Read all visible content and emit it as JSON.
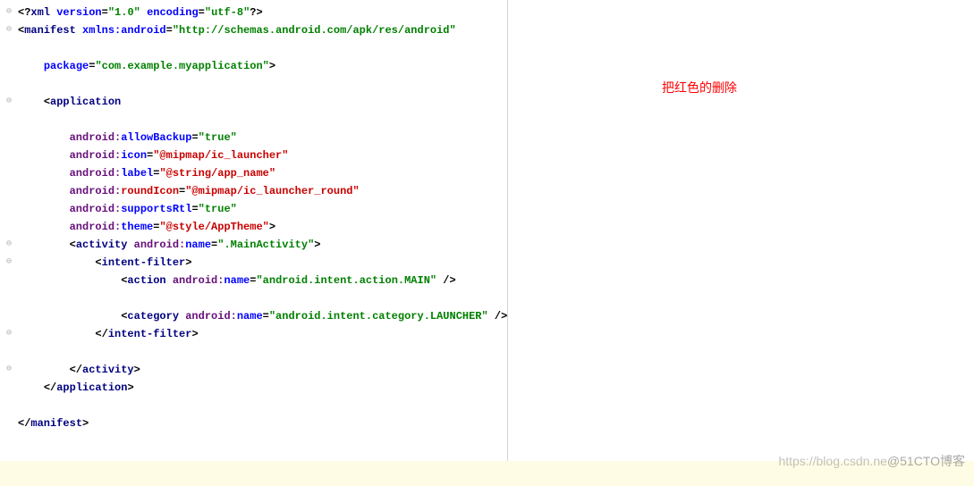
{
  "comment": "把红色的删除",
  "watermark_prefix": "https://blog.csdn.ne",
  "watermark_cn": "@51CTO博客",
  "code": {
    "xml_decl": {
      "open": "<?",
      "tag": "xml ",
      "a1": "version",
      "eq": "=",
      "v1": "\"1.0\"",
      "sp": " ",
      "a2": "encoding",
      "v2": "\"utf-8\"",
      "close": "?>"
    },
    "manifest_open": {
      "open": "<",
      "tag": "manifest ",
      "attr": "xmlns:android",
      "eq": "=",
      "val": "\"http://schemas.android.com/apk/res/android\""
    },
    "package": {
      "attr": "package",
      "eq": "=",
      "val": "\"com.example.myapplication\"",
      "close": ">"
    },
    "app_open": {
      "open": "<",
      "tag": "application"
    },
    "allowBackup": {
      "ns": "android:",
      "name": "allowBackup",
      "eq": "=",
      "val": "\"true\""
    },
    "icon": {
      "ns": "android:",
      "name": "icon",
      "eq": "=",
      "val": "\"@mipmap/ic_launcher\""
    },
    "label": {
      "ns": "android:",
      "name": "label",
      "eq": "=",
      "val": "\"@string/app_name\""
    },
    "roundIcon": {
      "ns": "android:",
      "name": "roundIcon",
      "eq": "=",
      "val": "\"@mipmap/ic_launcher_round\""
    },
    "supportsRtl": {
      "ns": "android:",
      "name": "supportsRtl",
      "eq": "=",
      "val": "\"true\""
    },
    "theme": {
      "ns": "android:",
      "name": "theme",
      "eq": "=",
      "val": "\"@style/AppTheme\"",
      "close": ">"
    },
    "activity": {
      "open": "<",
      "tag": "activity ",
      "ns": "android:",
      "name": "name",
      "eq": "=",
      "val": "\".MainActivity\"",
      "close": ">"
    },
    "intent_open": {
      "open": "<",
      "tag": "intent-filter",
      "close": ">"
    },
    "action": {
      "open": "<",
      "tag": "action ",
      "ns": "android:",
      "name": "name",
      "eq": "=",
      "val": "\"android.intent.action.MAIN\"",
      "close": " />"
    },
    "category": {
      "open": "<",
      "tag": "category ",
      "ns": "android:",
      "name": "name",
      "eq": "=",
      "val": "\"android.intent.category.LAUNCHER\"",
      "close": " />"
    },
    "intent_close": {
      "open": "</",
      "tag": "intent-filter",
      "close": ">"
    },
    "activity_close": {
      "open": "</",
      "tag": "activity",
      "close": ">"
    },
    "app_close": {
      "open": "</",
      "tag": "application",
      "close": ">"
    },
    "manifest_close": {
      "open": "</",
      "tag": "manifest",
      "close": ">"
    }
  },
  "fold_markers": [
    "⊖",
    "⊖",
    "⊖",
    "⊖",
    "⊖",
    "⊖",
    "⊖"
  ]
}
